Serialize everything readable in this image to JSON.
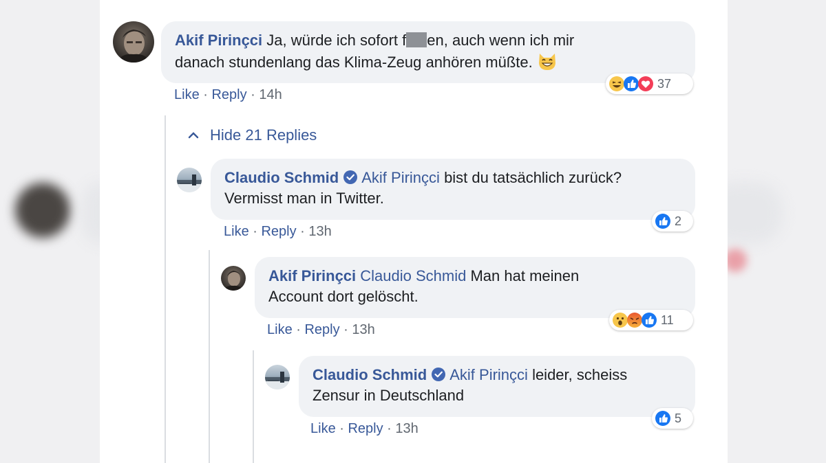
{
  "comments": [
    {
      "author": "Akif Pirinçci",
      "text_line1": "Ja, würde ich sofort f",
      "text_line1_after": "en, auch wenn ich mir",
      "text_line2": "danach stundenlang das Klima-Zeug anhören müßte.",
      "emoji": "grinning-cat-emoji",
      "actions": {
        "like": "Like",
        "reply": "Reply",
        "time": "14h"
      },
      "reactions": {
        "icons": [
          "haha-icon",
          "like-icon",
          "love-icon"
        ],
        "count": "37"
      },
      "hide_replies_label": "Hide 21 Replies"
    },
    {
      "author": "Claudio Schmid",
      "verified": true,
      "mention": "Akif Pirinçci",
      "text_line1": "bist du tatsächlich zurück?",
      "text_line2": "Vermisst man in Twitter.",
      "actions": {
        "like": "Like",
        "reply": "Reply",
        "time": "13h"
      },
      "reactions": {
        "icons": [
          "like-icon"
        ],
        "count": "2"
      }
    },
    {
      "author": "Akif Pirinçci",
      "mention": "Claudio Schmid",
      "text_line1": "Man hat meinen",
      "text_line2": "Account dort gelöscht.",
      "actions": {
        "like": "Like",
        "reply": "Reply",
        "time": "13h"
      },
      "reactions": {
        "icons": [
          "wow-icon",
          "angry-icon",
          "like-icon"
        ],
        "count": "11"
      }
    },
    {
      "author": "Claudio Schmid",
      "verified": true,
      "mention": "Akif Pirinçci",
      "text_line1": "leider, scheiss",
      "text_line2": "Zensur in Deutschland",
      "actions": {
        "like": "Like",
        "reply": "Reply",
        "time": "13h"
      },
      "reactions": {
        "icons": [
          "like-icon"
        ],
        "count": "5"
      }
    }
  ],
  "colors": {
    "link": "#385898",
    "bubble": "#f0f2f5",
    "like_blue": "#1877f2",
    "love_red": "#f33e58"
  }
}
